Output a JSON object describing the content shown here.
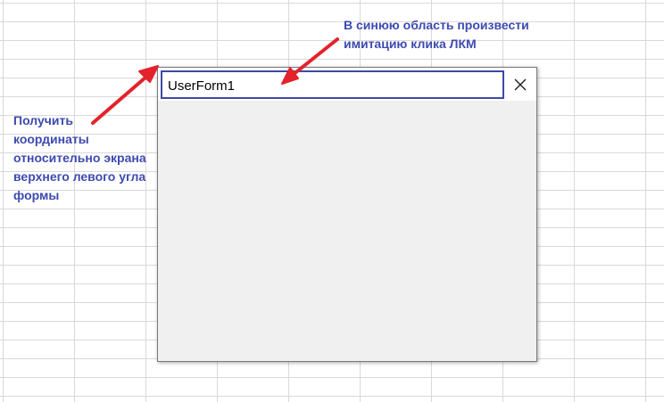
{
  "userform": {
    "title": "UserForm1",
    "close_label": "×"
  },
  "annotations": {
    "left_note": {
      "lines": [
        "Получить",
        "координаты",
        "относительно экрана",
        "верхнего левого угла",
        "формы"
      ]
    },
    "top_note": {
      "lines": [
        "В синюю область произвести",
        "имитацию клика ЛКМ"
      ]
    }
  },
  "colors": {
    "annotation_text": "#3d4ab0",
    "arrow": "#e3222b",
    "title_area_border": "#3c49a6",
    "form_background": "#f0f0f0",
    "grid_lines": "#d9d9d9"
  },
  "icons": {
    "close": "close-icon",
    "arrow_to_corner": "red-arrow-icon",
    "arrow_to_title": "red-arrow-icon"
  }
}
